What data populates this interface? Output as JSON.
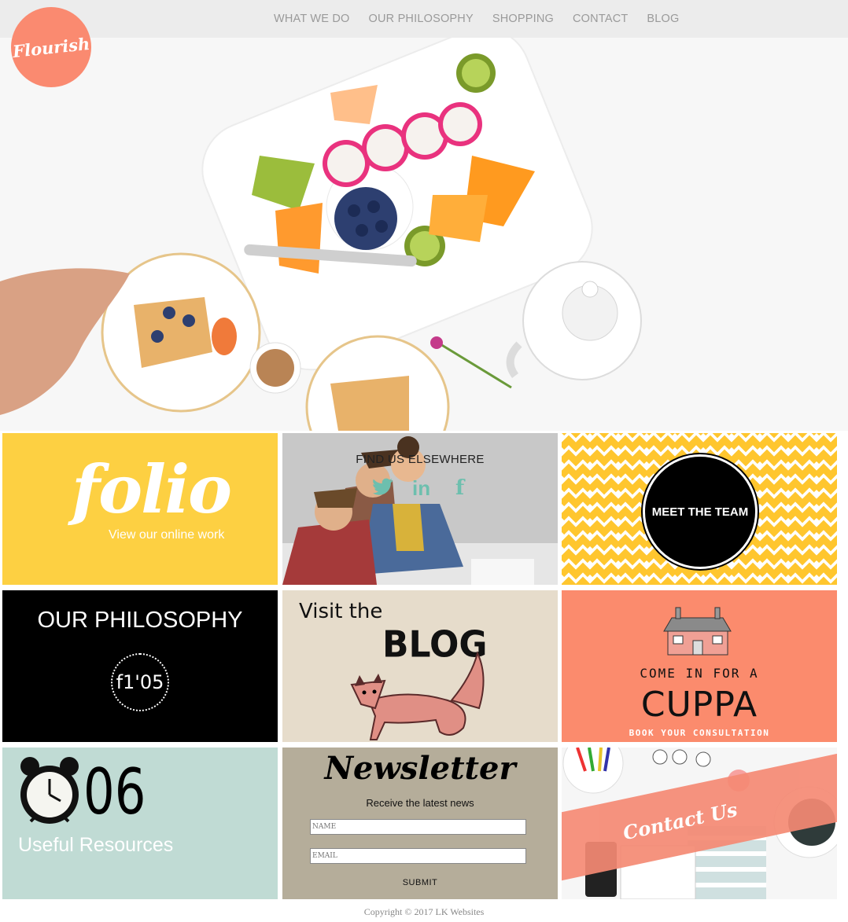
{
  "brand": {
    "logo_text": "Flourish"
  },
  "nav": {
    "items": [
      "WHAT WE DO",
      "OUR PHILOSOPHY",
      "SHOPPING",
      "CONTACT",
      "BLOG"
    ]
  },
  "tiles": {
    "folio": {
      "word": "folio",
      "subtitle": "View our online work"
    },
    "find": {
      "title": "FIND US ELSEWHERE",
      "icons": [
        "twitter-icon",
        "linkedin-icon",
        "facebook-icon"
      ],
      "linkedin_glyph": "in",
      "facebook_glyph": "f"
    },
    "team": {
      "label": "MEET THE TEAM"
    },
    "philosophy": {
      "title": "OUR PHILOSOPHY",
      "badge": "f1'05"
    },
    "blog": {
      "line1": "Visit the",
      "line2": "BLOG"
    },
    "cuppa": {
      "line1": "COME IN FOR A",
      "line2": "CUPPA",
      "line3": "BOOK YOUR CONSULTATION"
    },
    "resources": {
      "number": "06",
      "label": "Useful Resources"
    },
    "newsletter": {
      "title": "Newsletter",
      "subtitle": "Receive the latest news",
      "name_placeholder": "NAME",
      "email_placeholder": "EMAIL",
      "submit": "SUBMIT"
    },
    "contact": {
      "label": "Contact Us"
    }
  },
  "footer": {
    "copyright": "Copyright © 2017 LK Websites"
  },
  "colors": {
    "accent": "#fa8a70",
    "yellow": "#fdd042",
    "mint": "#c0dbd4",
    "taupe": "#b5ad9a",
    "beige": "#e6dccb",
    "social": "#6dbfae"
  }
}
